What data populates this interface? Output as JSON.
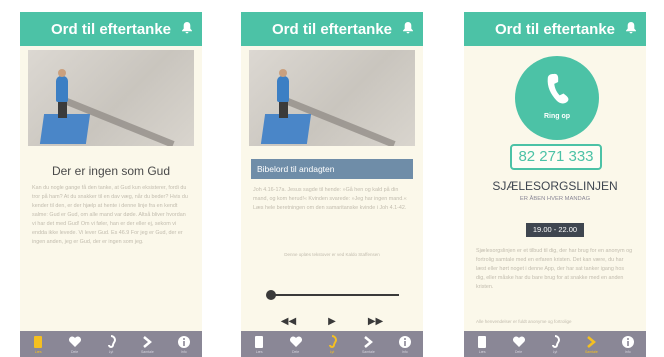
{
  "app_title": "Ord til eftertanke",
  "colors": {
    "accent": "#4cc2a6",
    "tabbar": "#8a8796",
    "active_tab": "#f5c020",
    "section_bar": "#6f8da8"
  },
  "tabs": [
    "Læs",
    "Dele",
    "Lyt",
    "Samtale",
    "Info"
  ],
  "screen1": {
    "heading": "Der er ingen som Gud",
    "body": "Kan du nogle gange få den tanke, at Gud kun eksisterer, fordi du tror på ham? At du snakker til en dav væg, når du beder? Hvis du kender til den, er der hjælp at hente i denne linje fra en kendt salme: Gud er Gud, om alle mand var døde. Altså bliver hvordan vi har det med Gud! Om vi føler, han er der eller ej, sekom vi endda ikke levede. Vi lever Gud. Es 46.9 For jeg er Gud, der er ingen anden, jeg er Gud, der er ingen som jeg.",
    "active_tab": 0
  },
  "screen2": {
    "section_title": "Bibelord til andagten",
    "body": "Joh 4.16-17a. Jesus sagde til hende: »Gå hen og kald på din mand, og kom herud!« Kvinden svarede: »Jeg har ingen mand.« Læs hele beretningen om den samaritanske kvinde i Joh 4.1-42.",
    "note": "Denne oplæs tekstover er ved Kaldo Staffensen",
    "progress": 0.0,
    "controls": {
      "rewind": "◀◀",
      "play": "▶",
      "forward": "▶▶"
    },
    "active_tab": 2
  },
  "screen3": {
    "call_label": "Ring op",
    "phone": "82 271 333",
    "service_name": "SJÆLESORGSLINJEN",
    "open_line": "ER ÅBEN HVER MANDAG",
    "hours": "19.00 - 22.00",
    "body": "Sjælesorgslinjen er et tilbud til dig, der har brug for en anonym og fortrolig samtale med en erfaren kristen. Det kan være, du har læst eller hørt noget i denne App, der har sat tanker igang hos dig, eller måske har du bare brug for at snakke med en anden kristen.",
    "footer": "Alle henvendelser er fuldt anonyme og fortrolige",
    "active_tab": 3
  }
}
